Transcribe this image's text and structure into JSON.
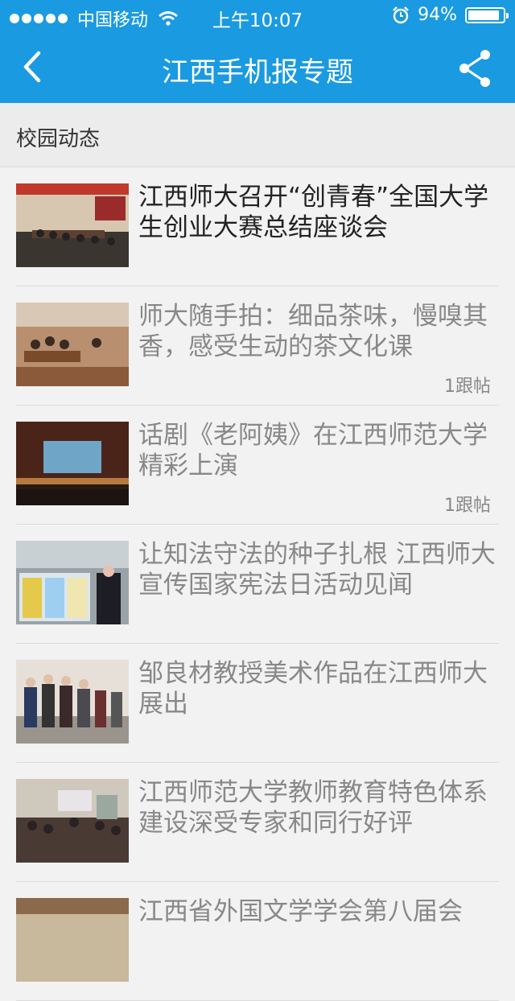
{
  "status_bar": {
    "carrier": "中国移动",
    "time": "上午10:07",
    "battery": "94%",
    "battery_level": 0.94
  },
  "nav": {
    "title": "江西手机报专题",
    "back_icon": "chevron-left-icon",
    "share_icon": "share-icon"
  },
  "section": {
    "title": "校园动态"
  },
  "colors": {
    "accent": "#1a9ae0",
    "title_read": "#222222",
    "title_unread": "#888888"
  },
  "articles": [
    {
      "title": "江西师大召开“创青春”全国大学生创业大赛总结座谈会",
      "replies": "",
      "read": true
    },
    {
      "title": "师大随手拍：细品茶味，慢嗅其香，感受生动的茶文化课",
      "replies": "1跟帖",
      "read": false
    },
    {
      "title": "话剧《老阿姨》在江西师范大学精彩上演",
      "replies": "1跟帖",
      "read": false
    },
    {
      "title": "让知法守法的种子扎根 江西师大宣传国家宪法日活动见闻",
      "replies": "",
      "read": false
    },
    {
      "title": "邹良材教授美术作品在江西师大展出",
      "replies": "",
      "read": false
    },
    {
      "title": "江西师范大学教师教育特色体系建设深受专家和同行好评",
      "replies": "",
      "read": false
    },
    {
      "title": "江西省外国文学学会第八届会",
      "replies": "",
      "read": false
    }
  ]
}
